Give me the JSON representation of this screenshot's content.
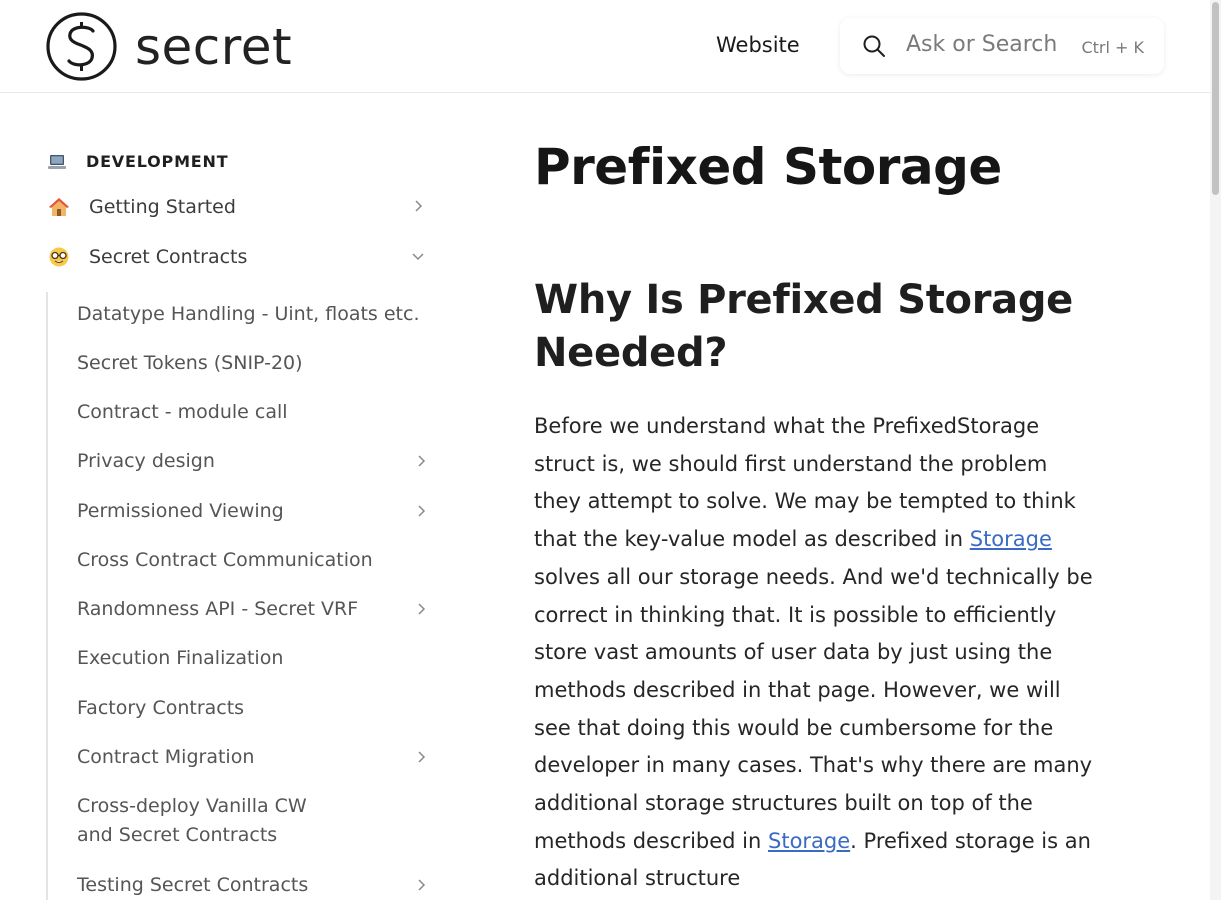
{
  "header": {
    "brand": "secret",
    "nav_website": "Website",
    "search_placeholder": "Ask or Search",
    "search_shortcut": "Ctrl + K"
  },
  "sidebar": {
    "section": {
      "icon": "laptop-icon",
      "label": "DEVELOPMENT"
    },
    "top_items": [
      {
        "icon": "house-icon",
        "label": "Getting Started",
        "state": "collapsed"
      },
      {
        "icon": "nerd-face-icon",
        "label": "Secret Contracts",
        "state": "expanded"
      }
    ],
    "sub_items": [
      {
        "label": "Datatype Handling - Uint, floats etc.",
        "has_children": false
      },
      {
        "label": "Secret Tokens (SNIP-20)",
        "has_children": false
      },
      {
        "label": "Contract - module call",
        "has_children": false
      },
      {
        "label": "Privacy design",
        "has_children": true
      },
      {
        "label": "Permissioned Viewing",
        "has_children": true
      },
      {
        "label": "Cross Contract Communication",
        "has_children": false
      },
      {
        "label": "Randomness API - Secret VRF",
        "has_children": true
      },
      {
        "label": "Execution Finalization",
        "has_children": false
      },
      {
        "label": "Factory Contracts",
        "has_children": false
      },
      {
        "label": "Contract Migration",
        "has_children": true
      },
      {
        "label_line1": "Cross-deploy Vanilla CW",
        "label_line2": "and Secret Contracts",
        "has_children": false
      },
      {
        "label": "Testing Secret Contracts",
        "has_children": true
      }
    ]
  },
  "content": {
    "title": "Prefixed Storage",
    "heading": "Why Is Prefixed Storage Needed?",
    "paragraph": {
      "part1": "Before we understand what the PrefixedStorage struct is, we should first understand the problem they attempt to solve. We may be tempted to think that the key-value model as described in ",
      "link1": "Storage",
      "part2": " solves all our storage needs. And we'd technically be correct in thinking that. It is possible to efficiently store vast amounts of user data by just using the methods described in that page. However, we will see that doing this would be cumbersome for the developer in many cases. That's why there are many additional storage structures built on top of the methods described in ",
      "link2": "Storage",
      "part3": ". Prefixed storage is an additional structure"
    }
  },
  "colors": {
    "link": "#3a6bc4",
    "text": "#262626",
    "sidebar_text": "#555555"
  }
}
